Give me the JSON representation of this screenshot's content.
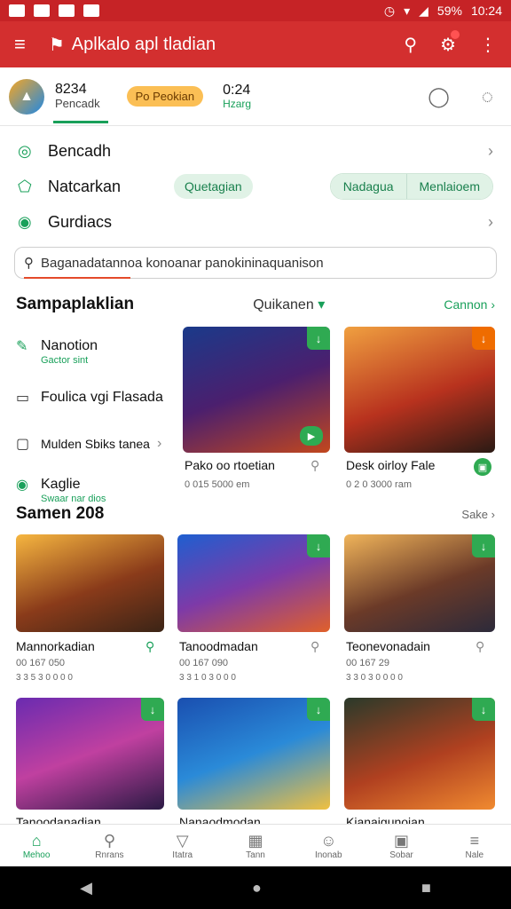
{
  "status": {
    "time": "10:24",
    "battery": "59%"
  },
  "appbar": {
    "title": "Aplkalo apl tladian"
  },
  "profile": {
    "code1": "8234",
    "sub1": "Pencadk",
    "pill": "Po Peokian",
    "code2": "0:24",
    "sub2": "Hzarg"
  },
  "menu": [
    {
      "label": "Bencadh"
    },
    {
      "label": "Natcarkan",
      "chip": "Quetagian",
      "seg": [
        "Nadagua",
        "Menlaioem"
      ]
    },
    {
      "label": "Gurdiacs"
    }
  ],
  "search": {
    "placeholder": "Baganadatannoa konoanar panokininaquanison"
  },
  "section1": {
    "title": "Sampaplaklian",
    "dropdown": "Quikanen",
    "more": "Cannon"
  },
  "sidelist": [
    {
      "title": "Nanotion",
      "sub": "Gactor sint"
    },
    {
      "title": "Foulica vgi Flasada",
      "sub": ""
    },
    {
      "title": "Mulden Sbiks tanea",
      "sub": ""
    },
    {
      "title": "Kaglie",
      "sub": "Swaar nar dios"
    }
  ],
  "cards_top": [
    {
      "title": "Pako oo rtoetian",
      "meta": "0 015 5000 em"
    },
    {
      "title": "Desk oirloy Fale",
      "meta": "0 2 0 3000 ram"
    }
  ],
  "section2": {
    "title": "Samen 208",
    "more": "Sake"
  },
  "cards_grid": [
    {
      "title": "Mannorkadian",
      "meta": "00 167 050",
      "meta2": "3 3 5 3 0 0 0 0"
    },
    {
      "title": "Tanoodmadan",
      "meta": "00 167 090",
      "meta2": "3 3 1 0 3 0 0 0"
    },
    {
      "title": "Teonevonadain",
      "meta": "00 167 29",
      "meta2": "3 3 0 3 0 0 0 0"
    },
    {
      "title": "Tanoodanadian",
      "meta": "",
      "meta2": ""
    },
    {
      "title": "Nanaodmodan",
      "meta": "",
      "meta2": ""
    },
    {
      "title": "Kianaigunoian",
      "meta": "",
      "meta2": ""
    }
  ],
  "bottomnav": [
    {
      "label": "Mehoo",
      "icon": "home-icon"
    },
    {
      "label": "Rnrans",
      "icon": "search-icon"
    },
    {
      "label": "Itatra",
      "icon": "send-icon"
    },
    {
      "label": "Tann",
      "icon": "grid-icon"
    },
    {
      "label": "Inonab",
      "icon": "user-icon"
    },
    {
      "label": "Sobar",
      "icon": "image-icon"
    },
    {
      "label": "Nale",
      "icon": "menu-icon"
    }
  ]
}
